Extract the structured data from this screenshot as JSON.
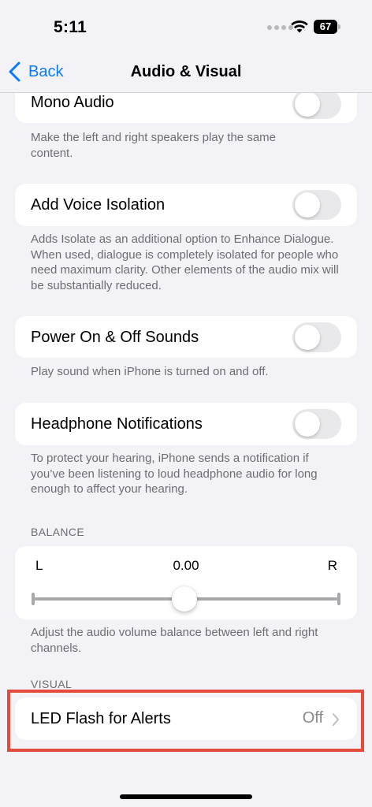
{
  "status_bar": {
    "time": "5:11",
    "battery": "67"
  },
  "nav": {
    "back_label": "Back",
    "title": "Audio & Visual"
  },
  "settings": [
    {
      "label": "Mono Audio",
      "on": false,
      "footnote": "Make the left and right speakers play the same content."
    },
    {
      "label": "Add Voice Isolation",
      "on": false,
      "footnote": "Adds Isolate as an additional option to Enhance Dialogue. When used, dialogue is completely isolated for people who need maximum clarity. Other elements of the audio mix will be substantially reduced."
    },
    {
      "label": "Power On & Off Sounds",
      "on": false,
      "footnote": "Play sound when iPhone is turned on and off."
    },
    {
      "label": "Headphone Notifications",
      "on": false,
      "footnote": "To protect your hearing, iPhone sends a notification if you’ve been listening to loud headphone audio for long enough to affect your hearing."
    }
  ],
  "balance": {
    "header": "BALANCE",
    "left": "L",
    "right": "R",
    "value": "0.00",
    "footnote": "Adjust the audio volume balance between left and right channels."
  },
  "visual": {
    "header": "VISUAL",
    "led_flash": {
      "label": "LED Flash for Alerts",
      "value": "Off"
    }
  },
  "colors": {
    "accent": "#0a7aff",
    "highlight": "#e34c3c",
    "background": "#f2f2f7"
  }
}
